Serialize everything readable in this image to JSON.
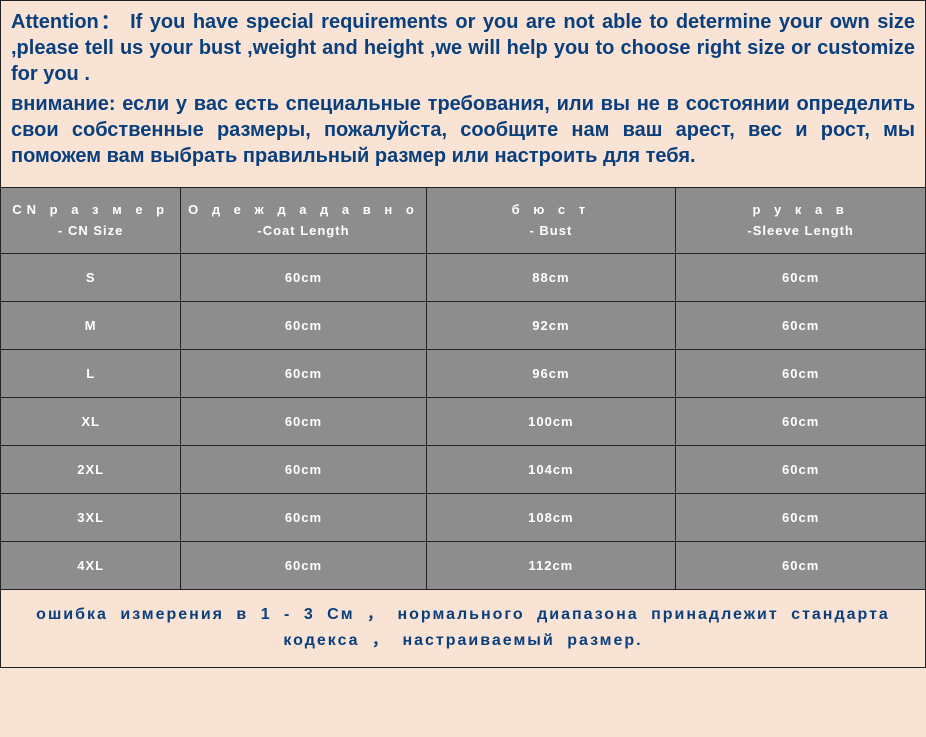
{
  "attention_en": "Attention： If you have special requirements or you are not able to determine your own size ,please tell us your bust ,weight and height ,we will help you to choose right size or customize for you .",
  "attention_ru": "внимание: если у вас есть специальные требования, или вы не в состоянии определить свои собственные размеры, пожалуйста, сообщите нам ваш арест, вес и рост, мы поможем вам выбрать правильный размер или настроить для тебя.",
  "headers": [
    {
      "ru": "CN р а з м е р",
      "en": "- CN Size"
    },
    {
      "ru": "О д е ж д а  д а в н о",
      "en": "-Coat Length"
    },
    {
      "ru": "б ю с т",
      "en": "- Bust"
    },
    {
      "ru": "р у к а в",
      "en": "-Sleeve Length"
    }
  ],
  "rows": [
    {
      "size": "S",
      "coat": "60cm",
      "bust": "88cm",
      "sleeve": "60cm"
    },
    {
      "size": "M",
      "coat": "60cm",
      "bust": "92cm",
      "sleeve": "60cm"
    },
    {
      "size": "L",
      "coat": "60cm",
      "bust": "96cm",
      "sleeve": "60cm"
    },
    {
      "size": "XL",
      "coat": "60cm",
      "bust": "100cm",
      "sleeve": "60cm"
    },
    {
      "size": "2XL",
      "coat": "60cm",
      "bust": "104cm",
      "sleeve": "60cm"
    },
    {
      "size": "3XL",
      "coat": "60cm",
      "bust": "108cm",
      "sleeve": "60cm"
    },
    {
      "size": "4XL",
      "coat": "60cm",
      "bust": "112cm",
      "sleeve": "60cm"
    }
  ],
  "bottom_note": "ошибка измерения в 1 - 3 См ， нормального диапазона принадлежит стандарта кодекса ， настраиваемый размер.",
  "chart_data": {
    "type": "table",
    "columns": [
      "CN Size",
      "Coat Length",
      "Bust",
      "Sleeve Length"
    ],
    "rows": [
      [
        "S",
        "60cm",
        "88cm",
        "60cm"
      ],
      [
        "M",
        "60cm",
        "92cm",
        "60cm"
      ],
      [
        "L",
        "60cm",
        "96cm",
        "60cm"
      ],
      [
        "XL",
        "60cm",
        "100cm",
        "60cm"
      ],
      [
        "2XL",
        "60cm",
        "104cm",
        "60cm"
      ],
      [
        "3XL",
        "60cm",
        "108cm",
        "60cm"
      ],
      [
        "4XL",
        "60cm",
        "112cm",
        "60cm"
      ]
    ],
    "title": "CN Size Chart"
  }
}
